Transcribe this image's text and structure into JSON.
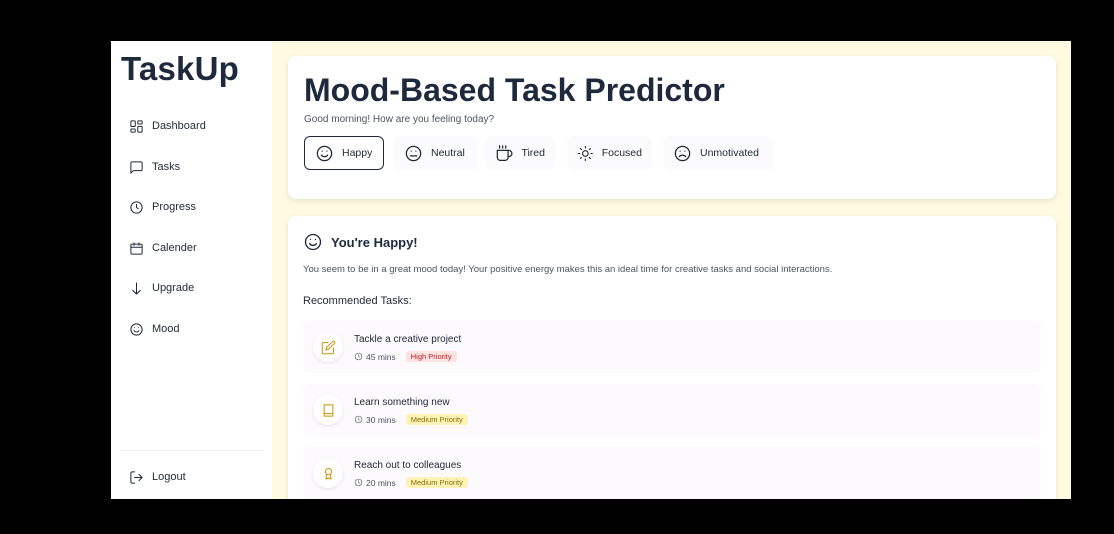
{
  "brand": "TaskUp",
  "nav": {
    "items": [
      {
        "label": "Dashboard",
        "icon": "dashboard-icon"
      },
      {
        "label": "Tasks",
        "icon": "chat-icon"
      },
      {
        "label": "Progress",
        "icon": "clock-icon"
      },
      {
        "label": "Calender",
        "icon": "calendar-icon"
      },
      {
        "label": "Upgrade",
        "icon": "arrow-down-icon"
      },
      {
        "label": "Mood",
        "icon": "smile-icon"
      }
    ],
    "logout": "Logout"
  },
  "mood": {
    "title": "Mood-Based Task Predictor",
    "subtitle": "Good morning! How are you feeling today?",
    "options": [
      {
        "label": "Happy",
        "icon": "happy-face-icon",
        "selected": true
      },
      {
        "label": "Neutral",
        "icon": "neutral-face-icon",
        "selected": false
      },
      {
        "label": "Tired",
        "icon": "coffee-cup-icon",
        "selected": false
      },
      {
        "label": "Focused",
        "icon": "sun-icon",
        "selected": false
      },
      {
        "label": "Unmotivated",
        "icon": "sad-face-icon",
        "selected": false
      }
    ]
  },
  "result": {
    "title": "You're Happy!",
    "description": "You seem to be in a great mood today! Your positive energy makes this an ideal time for creative tasks and social interactions.",
    "recommended_heading": "Recommended Tasks:",
    "tasks": [
      {
        "title": "Tackle a creative project",
        "duration": "45 mins",
        "priority": "High Priority",
        "level": "high",
        "icon": "edit-icon"
      },
      {
        "title": "Learn something new",
        "duration": "30 mins",
        "priority": "Medium Priority",
        "level": "medium",
        "icon": "book-icon"
      },
      {
        "title": "Reach out to colleagues",
        "duration": "20 mins",
        "priority": "Medium Priority",
        "level": "medium",
        "icon": "award-icon"
      }
    ]
  },
  "colors": {
    "app_background": "#fffbe0",
    "heading": "#1e2a3b",
    "task_icon": "#c8940a",
    "high_badge_bg": "#fde2e2",
    "high_badge_text": "#b91c1c",
    "medium_badge_bg": "#fdf3b6",
    "medium_badge_text": "#8a6d05"
  }
}
